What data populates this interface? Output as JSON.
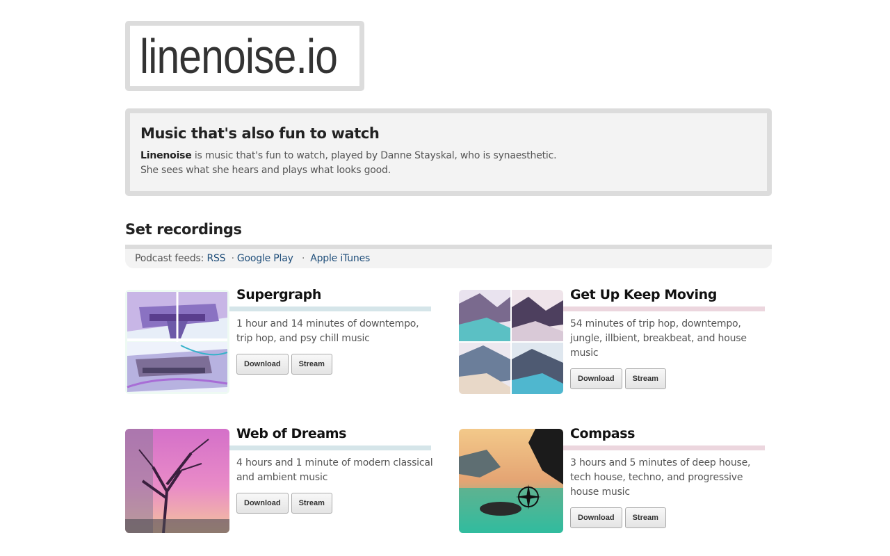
{
  "site": {
    "logo_text": "linenoise.io"
  },
  "intro": {
    "title": "Music that's also fun to watch",
    "brand": "Linenoise",
    "line1": "is music that's fun to watch, played by Danne Stayskal, who is synaesthetic.",
    "line2": "She sees what she hears and plays what looks good."
  },
  "recordings": {
    "heading": "Set recordings",
    "feeds_label": "Podcast feeds:",
    "feeds": [
      "RSS",
      "Google Play",
      "Apple iTunes"
    ],
    "separator": "·"
  },
  "items": [
    {
      "title": "Supergraph",
      "desc": "1 hour and 14 minutes of downtempo, trip hop, and psy chill music",
      "download": "Download",
      "stream": "Stream"
    },
    {
      "title": "Get Up Keep Moving",
      "desc": "54 minutes of trip hop, downtempo, jungle, illbient, breakbeat, and house music",
      "download": "Download",
      "stream": "Stream"
    },
    {
      "title": "Web of Dreams",
      "desc": "4 hours and 1 minute of modern classical and ambient music",
      "download": "Download",
      "stream": "Stream"
    },
    {
      "title": "Compass",
      "desc": "3 hours and 5 minutes of deep house, tech house, techno, and progressive house music",
      "download": "Download",
      "stream": "Stream"
    }
  ],
  "colors": {
    "panel_border": "#dcdcdc",
    "panel_bg": "#f3f3f3",
    "link": "#1f4e7a",
    "rule_blue": "#d5e5e9",
    "rule_pink": "#ecd6de"
  }
}
